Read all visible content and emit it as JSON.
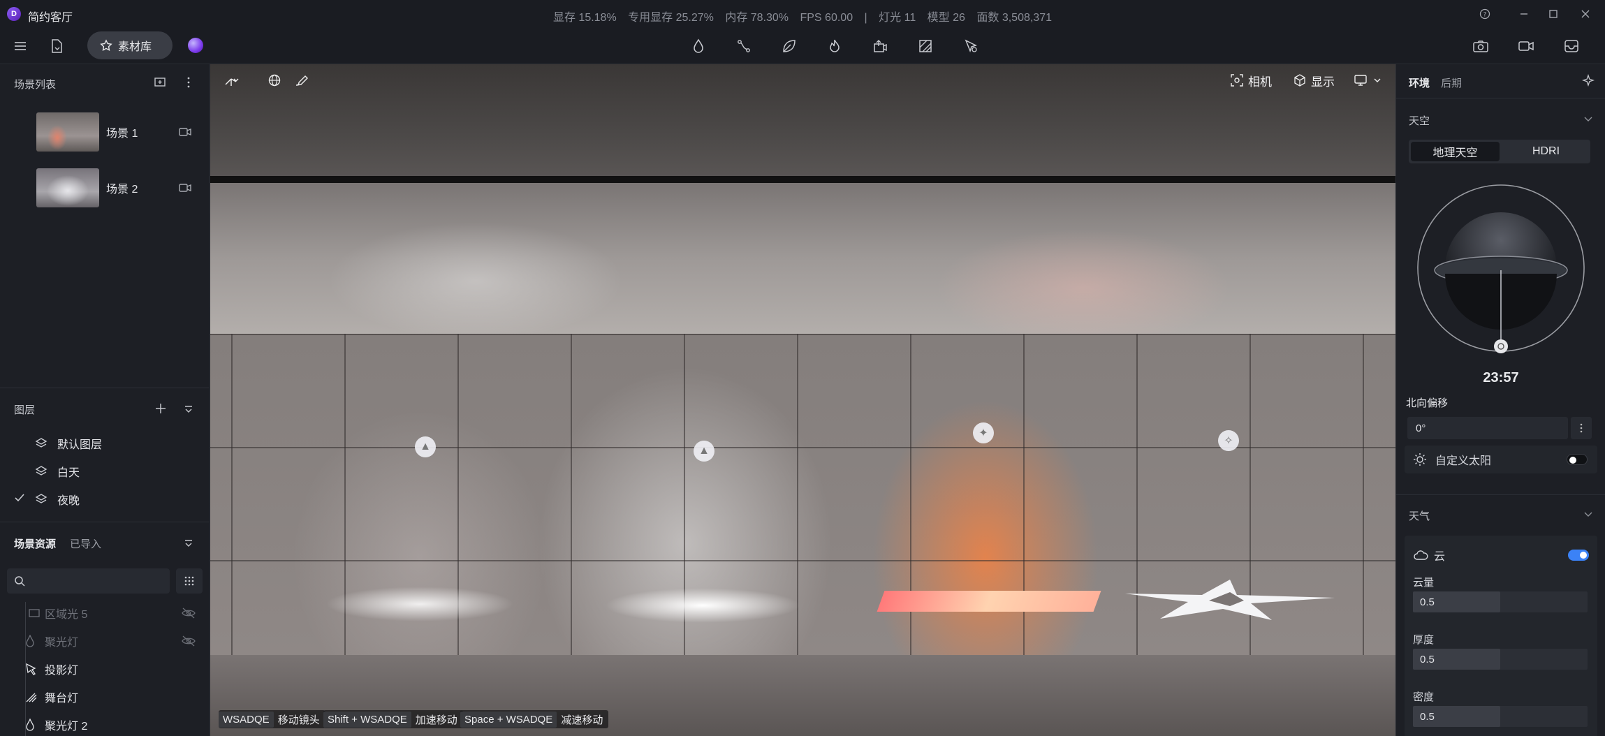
{
  "titlebar": {
    "app_title": "简约客厅",
    "stats": [
      "显存 15.18%",
      "专用显存 25.27%",
      "内存 78.30%",
      "FPS 60.00",
      "|",
      "灯光 11",
      "模型 26",
      "面数 3,508,371"
    ]
  },
  "toolbar": {
    "material_label": "素材库",
    "center_icons": [
      "droplet-icon",
      "path-icon",
      "leaf-icon",
      "flame-icon",
      "export-icon",
      "texture-icon",
      "cursor-icon"
    ],
    "right_icons": [
      "camera-icon",
      "video-icon",
      "inbox-icon"
    ]
  },
  "scene_list": {
    "title": "场景列表",
    "items": [
      {
        "label": "场景 1",
        "thumb_color": "#c8766a"
      },
      {
        "label": "场景 2",
        "thumb_color": "#c9c9cf"
      }
    ]
  },
  "layers": {
    "title": "图层",
    "items": [
      {
        "label": "默认图层",
        "checked": false
      },
      {
        "label": "白天",
        "checked": false
      },
      {
        "label": "夜晚",
        "checked": true
      }
    ]
  },
  "resources": {
    "tabs": [
      "场景资源",
      "已导入"
    ],
    "search_placeholder": "",
    "items": [
      {
        "label": "区域光 5",
        "dim": true,
        "hidden": true
      },
      {
        "label": "聚光灯",
        "dim": true,
        "hidden": true
      },
      {
        "label": "投影灯",
        "dim": false,
        "hidden": false
      },
      {
        "label": "舞台灯",
        "dim": false,
        "hidden": false
      },
      {
        "label": "聚光灯 2",
        "dim": false,
        "hidden": false
      }
    ]
  },
  "viewport": {
    "camera_label": "相机",
    "display_label": "显示",
    "hints": [
      {
        "key": "WSADQE",
        "desc": "移动镜头"
      },
      {
        "key": "Shift + WSADQE",
        "desc": "加速移动"
      },
      {
        "key": "Space + WSADQE",
        "desc": "减速移动"
      }
    ]
  },
  "right_panel": {
    "tabs": [
      "环境",
      "后期"
    ],
    "sky": {
      "title": "天空",
      "tabs": [
        "地理天空",
        "HDRI"
      ],
      "time": "23:57",
      "north_label": "北向偏移",
      "north_value": "0°",
      "custom_sun_label": "自定义太阳",
      "custom_sun_on": false
    },
    "weather": {
      "title": "天气",
      "cloud_label": "云",
      "cloud_on": true,
      "params": [
        {
          "label": "云量",
          "value": "0.5",
          "fraction": 0.5
        },
        {
          "label": "厚度",
          "value": "0.5",
          "fraction": 0.5
        },
        {
          "label": "密度",
          "value": "0.5",
          "fraction": 0.5
        }
      ]
    }
  }
}
